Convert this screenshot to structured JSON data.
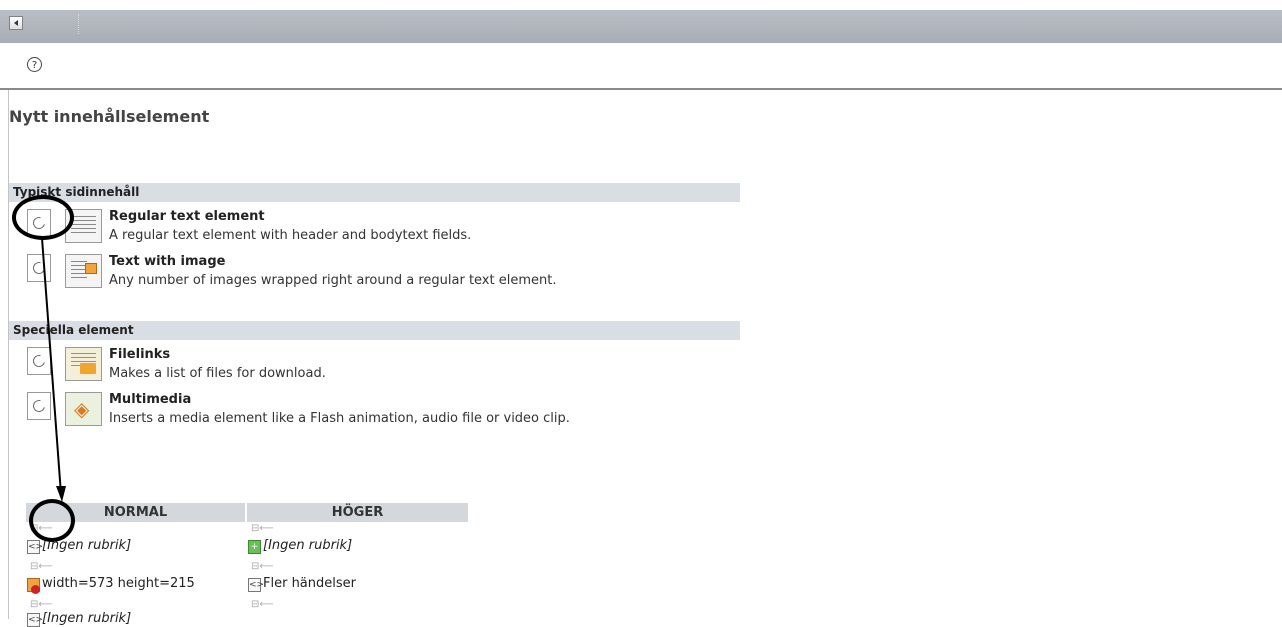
{
  "header": {
    "help_symbol": "?",
    "back_icon": "back-arrow-icon"
  },
  "page": {
    "title": "Nytt innehållselement"
  },
  "sections": [
    {
      "heading": "Typiskt sidinnehåll",
      "items": [
        {
          "title": "Regular text element",
          "desc": "A regular text element with header and bodytext fields.",
          "icon": "text-element-icon"
        },
        {
          "title": "Text with image",
          "desc": "Any number of images wrapped right around a regular text element.",
          "icon": "text-image-icon"
        }
      ]
    },
    {
      "heading": "Speciella element",
      "items": [
        {
          "title": "Filelinks",
          "desc": "Makes a list of files for download.",
          "icon": "filelinks-icon"
        },
        {
          "title": "Multimedia",
          "desc": "Inserts a media element like a Flash animation, audio file or video clip.",
          "icon": "multimedia-icon"
        }
      ]
    }
  ],
  "columns": {
    "normal": "NORMAL",
    "hoger": "HÖGER",
    "normal_records": [
      "[Ingen rubrik]",
      "width=573 height=215",
      "[Ingen rubrik]"
    ],
    "hoger_records": [
      "[Ingen rubrik]",
      "Fler händelser"
    ]
  },
  "paste_glyph": "⊟⟵",
  "colors": {
    "toolbar": "#b0b4bb",
    "section_bg": "#d9dde4",
    "annotation": "#000000"
  }
}
